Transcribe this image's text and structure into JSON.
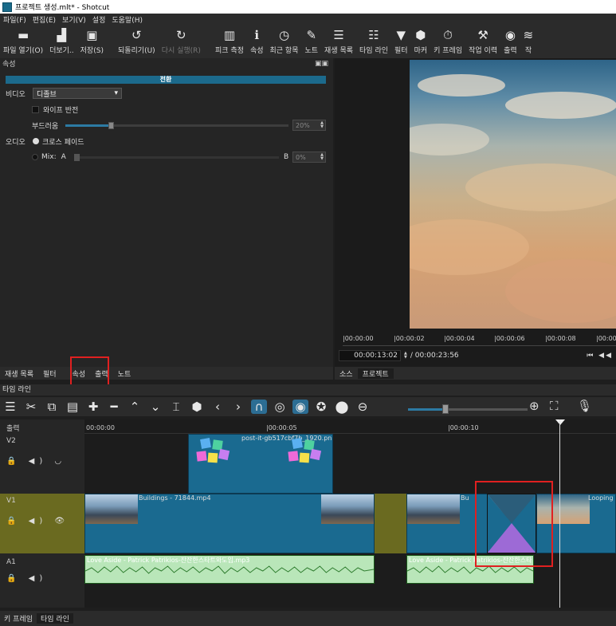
{
  "window": {
    "title": "프로젝트 생성.mlt* - Shotcut"
  },
  "menu": [
    "파일(F)",
    "편집(E)",
    "보기(V)",
    "설정",
    "도움말(H)"
  ],
  "toolbar": [
    {
      "icon": "folder-open-icon",
      "glyph": "▬",
      "label": "파일 열기(O)",
      "disabled": false
    },
    {
      "icon": "more-icon",
      "glyph": "▟",
      "label": "더보기..",
      "disabled": false
    },
    {
      "icon": "save-icon",
      "glyph": "▣",
      "label": "저장(S)",
      "disabled": false
    },
    {
      "icon": "undo-icon",
      "glyph": "↺",
      "label": "되돌리기(U)",
      "disabled": false
    },
    {
      "icon": "redo-icon",
      "glyph": "↻",
      "label": "다시 실행(R)",
      "disabled": true
    },
    {
      "icon": "peak-meter-icon",
      "glyph": "▥",
      "label": "피크 측정",
      "disabled": false
    },
    {
      "icon": "info-icon",
      "glyph": "ℹ",
      "label": "속성",
      "disabled": false
    },
    {
      "icon": "recent-icon",
      "glyph": "◷",
      "label": "최근 항목",
      "disabled": false
    },
    {
      "icon": "notes-icon",
      "glyph": "✎",
      "label": "노트",
      "disabled": false
    },
    {
      "icon": "playlist-icon",
      "glyph": "☰",
      "label": "재생 목록",
      "disabled": false
    },
    {
      "icon": "timeline-icon",
      "glyph": "☷",
      "label": "타임 라인",
      "disabled": false
    },
    {
      "icon": "filter-icon",
      "glyph": "▼",
      "label": "필터",
      "disabled": false
    },
    {
      "icon": "marker-icon",
      "glyph": "⬢",
      "label": "마커",
      "disabled": false
    },
    {
      "icon": "keyframe-icon",
      "glyph": "⏱",
      "label": "키 프레임",
      "disabled": false
    },
    {
      "icon": "history-icon",
      "glyph": "⚒",
      "label": "작업 이력",
      "disabled": false
    },
    {
      "icon": "export-icon",
      "glyph": "◉",
      "label": "출력",
      "disabled": false
    },
    {
      "icon": "jobs-icon",
      "glyph": "≋",
      "label": "작",
      "disabled": false
    }
  ],
  "properties": {
    "panel_title": "속성",
    "panel_buttons": "▣▣",
    "banner": "전환",
    "video_label": "비디오",
    "video_value": "디졸브",
    "wipe_invert": "와이프 반전",
    "softness_label": "부드러움",
    "softness_value": "20%",
    "audio_label": "오디오",
    "crossfade": "크로스 페이드",
    "mix_label": "Mix:",
    "mix_a": "A",
    "mix_b": "B",
    "mix_value": "0%"
  },
  "left_tabs": [
    "재생 목록",
    "필터",
    "속성",
    "출력",
    "노트"
  ],
  "viewer": {
    "ruler": [
      "|00:00:00",
      "|00:00:02",
      "|00:00:04",
      "|00:00:06",
      "|00:00:08",
      "|00:00"
    ],
    "timecode": "00:00:13:02",
    "duration": "/ 00:00:23:56",
    "tabs": [
      "소스",
      "프로젝트"
    ],
    "transport": "⏮ ◀◀"
  },
  "timeline": {
    "title": "타임 라인",
    "ruler": [
      "00:00:00",
      "|00:00:05",
      "|00:00:10"
    ],
    "tracks": [
      {
        "name": "출력",
        "controls": ""
      },
      {
        "name": "V2",
        "controls": "🔒 ◀) ◡"
      },
      {
        "name": "V1",
        "controls": "🔒 ◀) 👁"
      },
      {
        "name": "A1",
        "controls": "🔒 ◀)"
      }
    ],
    "clips": {
      "v2_clip": "post-it-gb517cbf7b_1920.pn",
      "v1_clip1": "Buildings - 71844.mp4",
      "v1_clip2": "Bu",
      "v1_clip3": "Looping",
      "a1_clip1": "Love Aside - Patrick Patrikios-잔잔한스타트와도입.mp3",
      "a1_clip2": "Love Aside - Patrick Patrikios-잔잔한스타"
    }
  },
  "bottom_tabs": [
    "키 프레임",
    "타임 라인"
  ],
  "colors": {
    "accent": "#1c6a8c",
    "highlight": "#e02020",
    "audio": "#b9e6b9",
    "gap": "#6a6a20"
  }
}
